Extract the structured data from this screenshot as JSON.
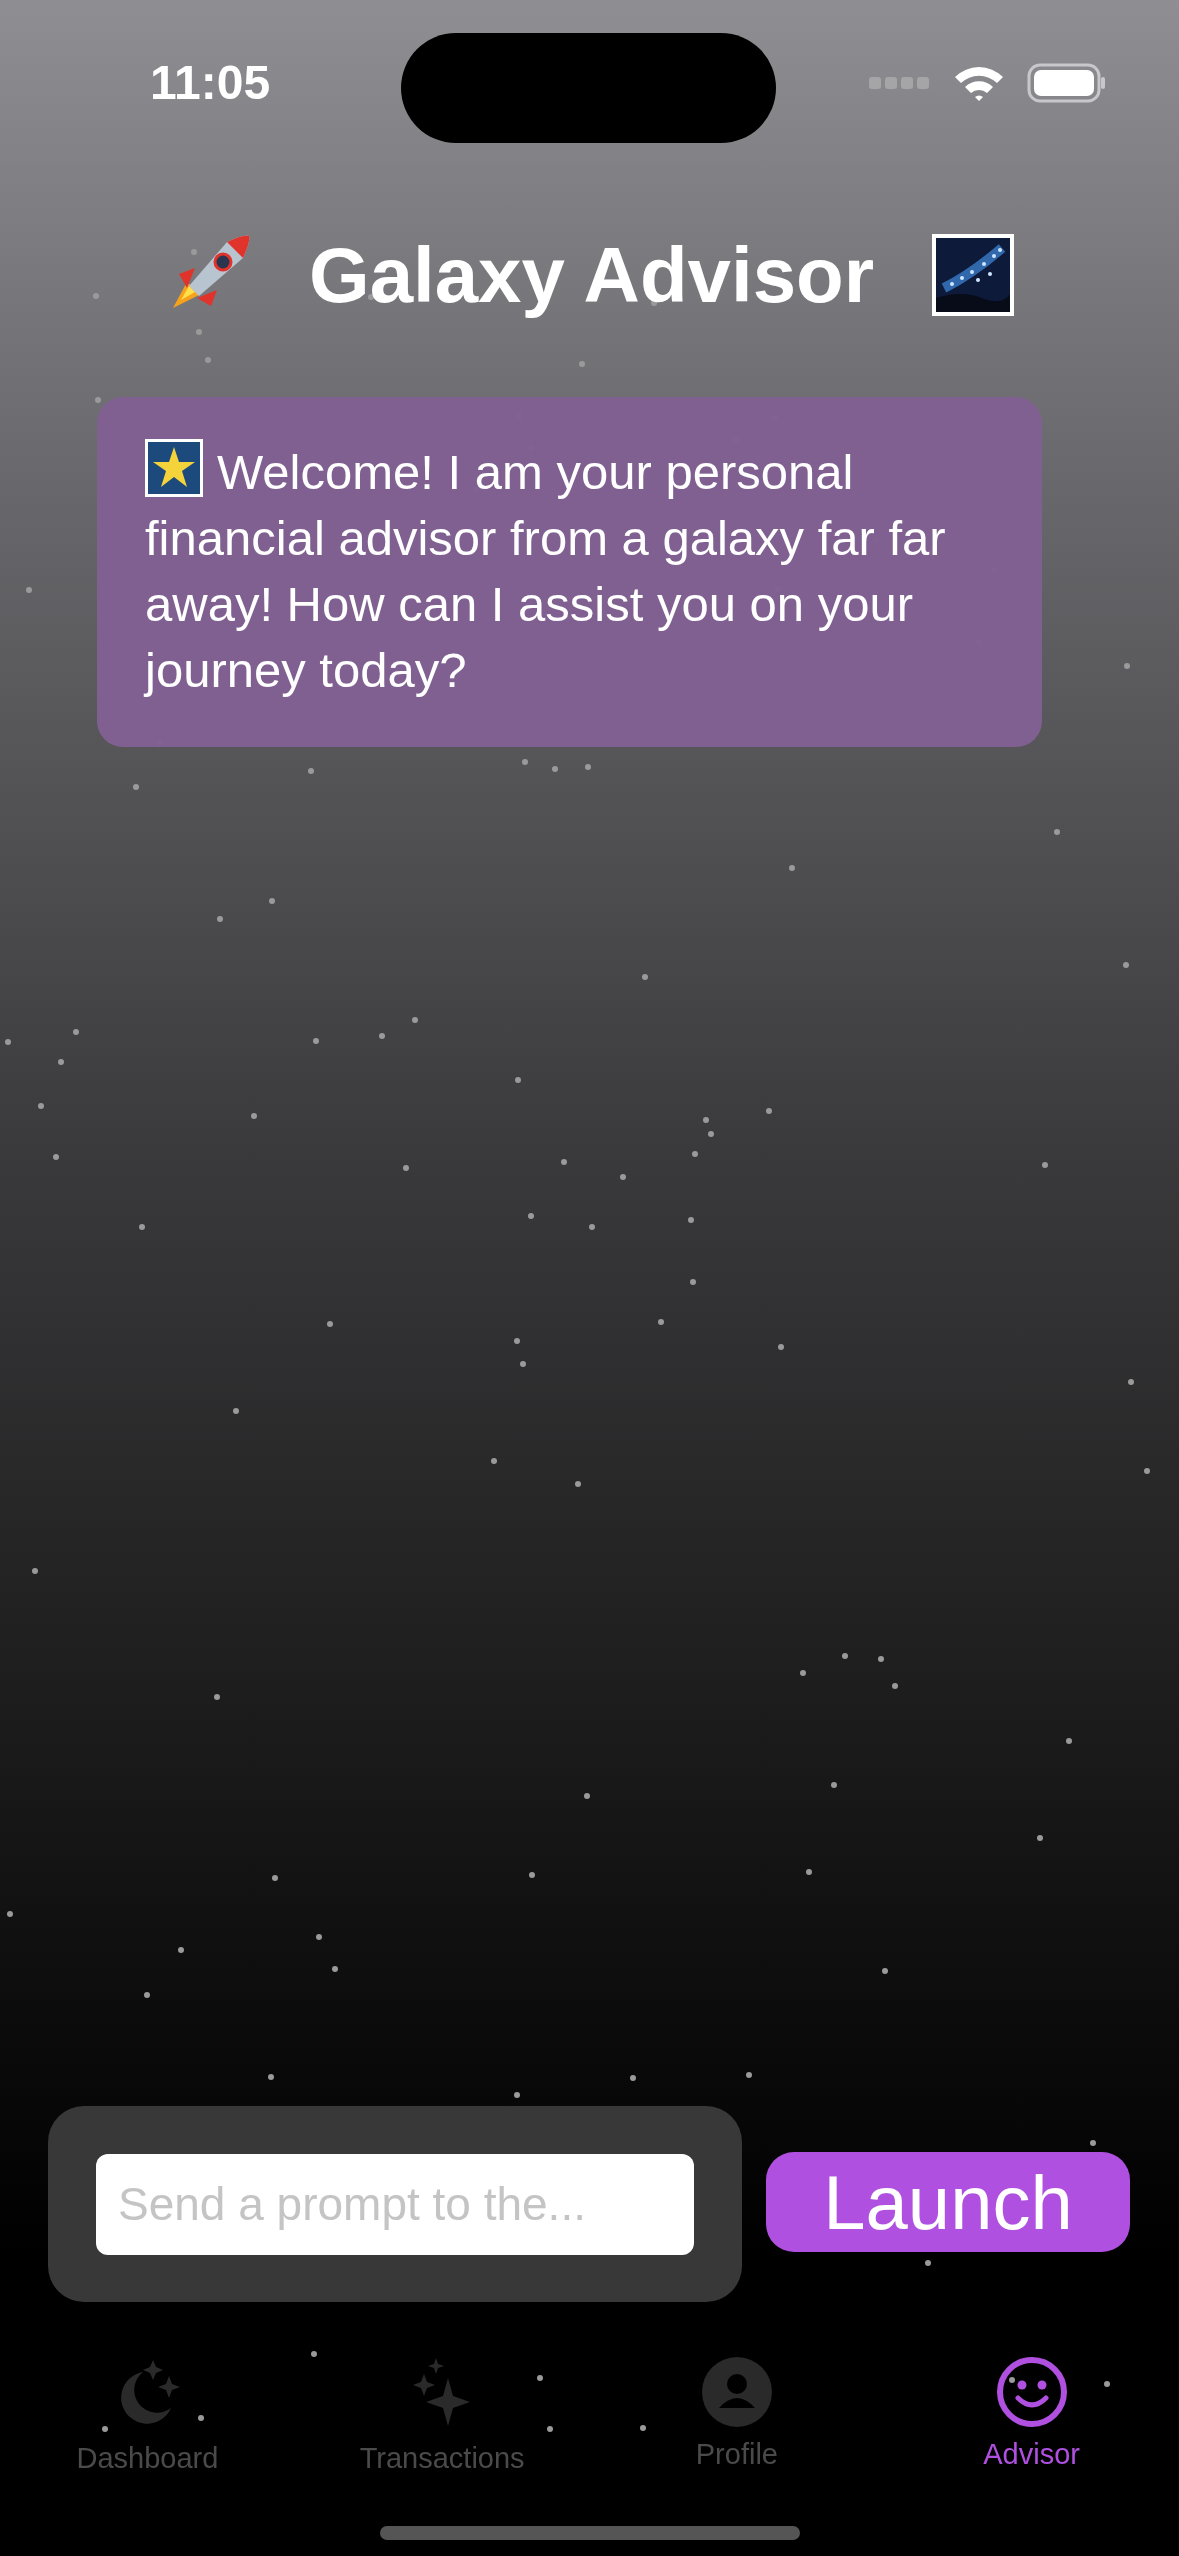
{
  "status_bar": {
    "time": "11:05"
  },
  "header": {
    "title": "Galaxy Advisor"
  },
  "messages": [
    {
      "text": "Welcome! I am your personal financial advisor from a galaxy far far away! How can I assist you on your journey today?"
    }
  ],
  "prompt": {
    "placeholder": "Send a prompt to the..."
  },
  "launch_button": {
    "label": "Launch"
  },
  "tabs": [
    {
      "label": "Dashboard",
      "selected": false
    },
    {
      "label": "Transactions",
      "selected": false
    },
    {
      "label": "Profile",
      "selected": false
    },
    {
      "label": "Advisor",
      "selected": true
    }
  ]
}
